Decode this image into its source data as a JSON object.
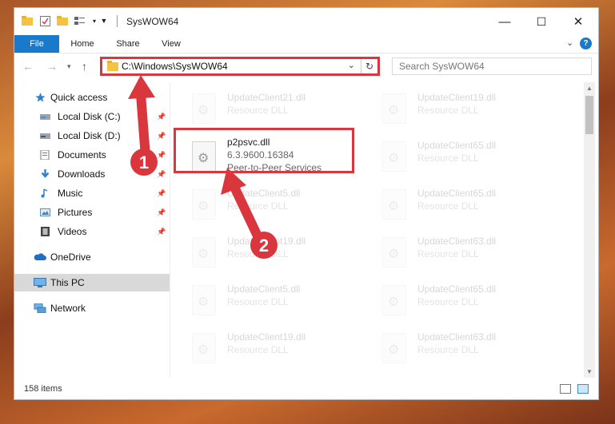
{
  "window": {
    "title": "SysWOW64",
    "buttons": {
      "minimize": "—",
      "maximize": "☐",
      "close": "✕"
    }
  },
  "ribbon": {
    "tabs": [
      {
        "label": "File"
      },
      {
        "label": "Home"
      },
      {
        "label": "Share"
      },
      {
        "label": "View"
      }
    ],
    "help": "?"
  },
  "address": {
    "path": "C:\\Windows\\SysWOW64",
    "search_placeholder": "Search SysWOW64"
  },
  "nav": {
    "items": [
      {
        "label": "Quick access"
      },
      {
        "label": "Local Disk (C:)"
      },
      {
        "label": "Local Disk (D:)"
      },
      {
        "label": "Documents"
      },
      {
        "label": "Downloads"
      },
      {
        "label": "Music"
      },
      {
        "label": "Pictures"
      },
      {
        "label": "Videos"
      },
      {
        "label": "OneDrive"
      },
      {
        "label": "This PC"
      },
      {
        "label": "Network"
      }
    ]
  },
  "files": {
    "left": [
      {
        "name": "UpdateClient21.dll",
        "type": "Resource DLL"
      },
      {
        "name": "p2psvc.dll",
        "version": "6.3.9600.16384",
        "type": "Peer-to-Peer Services"
      },
      {
        "name": "UpdateClient5.dll",
        "type": "Resource DLL"
      },
      {
        "name": "UpdateClient19.dll",
        "type": "Resource DLL"
      },
      {
        "name": "UpdateClient5.dll",
        "type": "Resource DLL"
      },
      {
        "name": "UpdateClient19.dll",
        "type": "Resource DLL"
      }
    ],
    "right": [
      {
        "name": "UpdateClient19.dll",
        "type": "Resource DLL"
      },
      {
        "name": "UpdateClient65.dll",
        "type": "Resource DLL"
      },
      {
        "name": "UpdateClient65.dll",
        "type": "Resource DLL"
      },
      {
        "name": "UpdateClient63.dll",
        "type": "Resource DLL"
      },
      {
        "name": "UpdateClient65.dll",
        "type": "Resource DLL"
      },
      {
        "name": "UpdateClient63.dll",
        "type": "Resource DLL"
      }
    ]
  },
  "status": {
    "item_count": "158 items"
  },
  "annotations": {
    "badge1": "1",
    "badge2": "2",
    "highlight_color": "#d9363e"
  }
}
